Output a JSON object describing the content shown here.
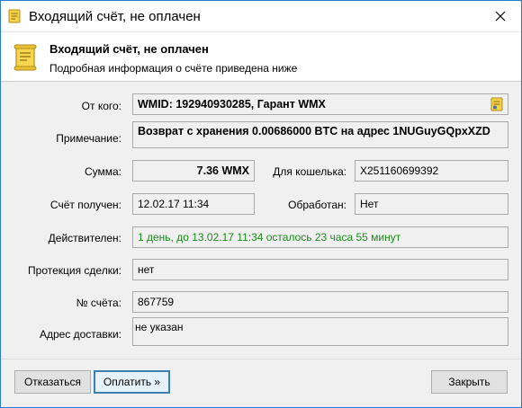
{
  "window": {
    "title": "Входящий счёт, не оплачен",
    "close_glyph": "✕"
  },
  "header": {
    "title": "Входящий счёт, не оплачен",
    "subtitle": "Подробная информация о счёте приведена ниже",
    "icon": "invoice-scroll-icon"
  },
  "form": {
    "from_label": "От кого:",
    "from_value": "WMID: 192940930285, Гарант WMX",
    "note_label": "Примечание:",
    "note_value": "Возврат с хранения 0.00686000 BTC на адрес 1NUGuyGQpxXZD",
    "amount_label": "Сумма:",
    "amount_value": "7.36 WMX",
    "purse_label": "Для кошелька:",
    "purse_value": "X251160699392",
    "received_label": "Счёт получен:",
    "received_value": "12.02.17 11:34",
    "processed_label": "Обработан:",
    "processed_value": "Нет",
    "valid_label": "Действителен:",
    "valid_value": "1 день, до 13.02.17 11:34 осталось 23 часа 55 минут",
    "protection_label": "Протекция сделки:",
    "protection_value": "нет",
    "number_label": "№ счёта:",
    "number_value": "867759",
    "address_label": "Адрес доставки:",
    "address_value": "не указан"
  },
  "buttons": {
    "decline": "Отказаться",
    "pay": "Оплатить »",
    "close": "Закрыть"
  },
  "colors": {
    "valid_text": "#1a8a1a",
    "window_border": "#2b79d0",
    "default_button_border": "#3c7fb1"
  }
}
